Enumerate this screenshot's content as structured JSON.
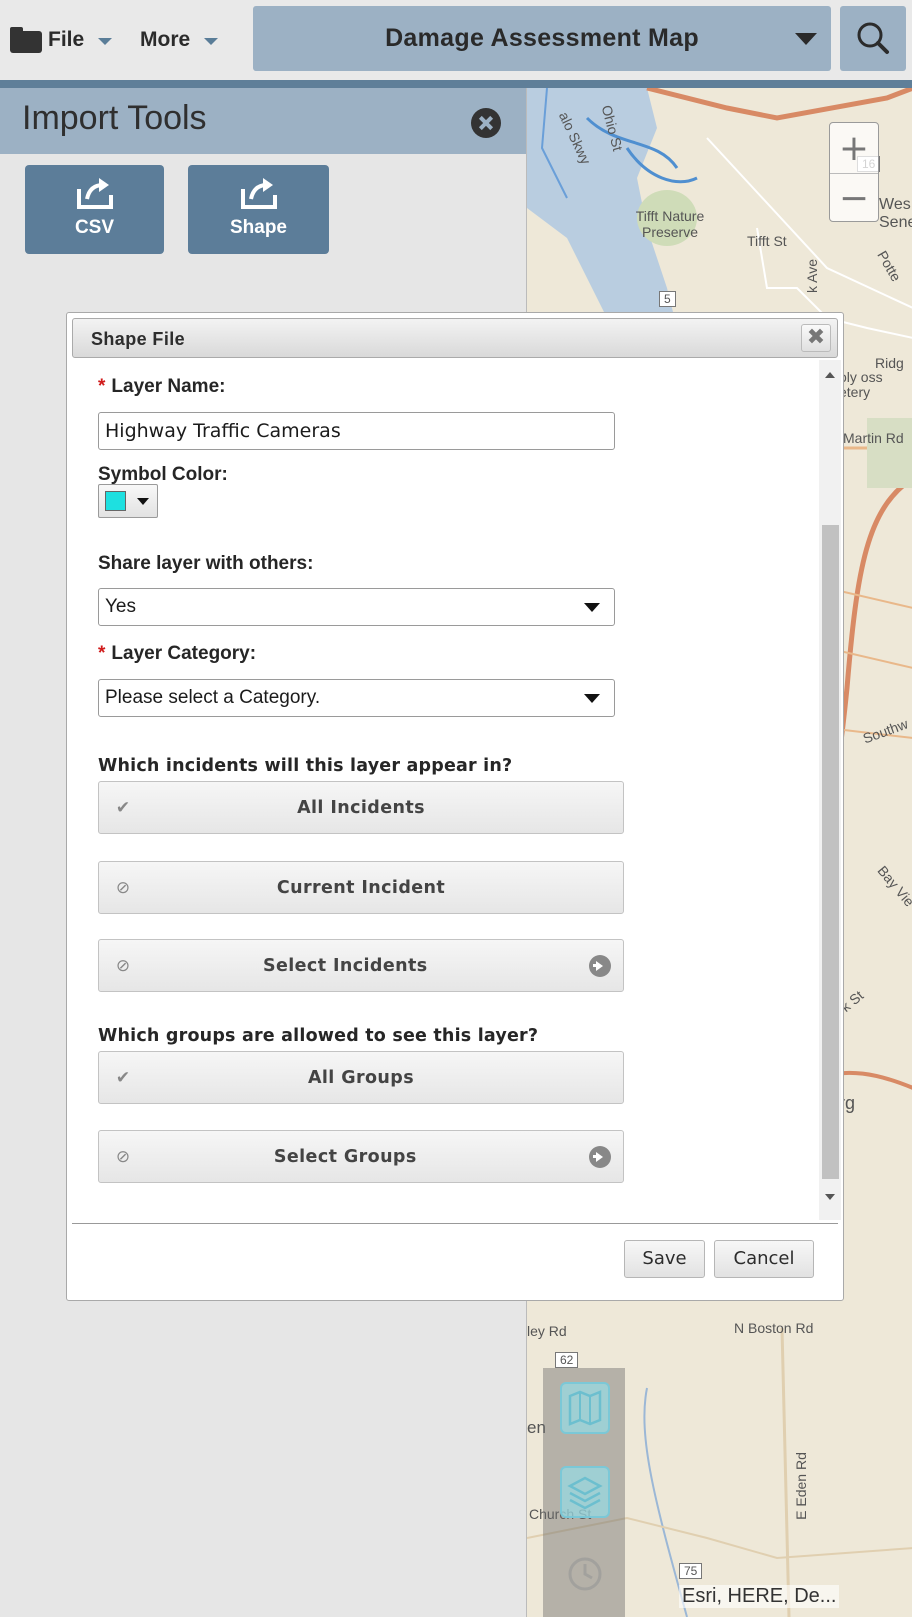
{
  "topbar": {
    "file_label": "File",
    "more_label": "More",
    "map_title": "Damage Assessment Map"
  },
  "import_panel": {
    "title": "Import Tools",
    "tools": [
      {
        "label": "CSV"
      },
      {
        "label": "Shape"
      }
    ]
  },
  "dialog": {
    "title": "Shape File",
    "close_glyph": "✖",
    "layer_name": {
      "label": "Layer Name:",
      "value": "Highway Traffic Cameras"
    },
    "symbol_color": {
      "label": "Symbol Color:",
      "value": "#1ee0e0"
    },
    "share_layer": {
      "label": "Share layer with others:",
      "value": "Yes"
    },
    "layer_category": {
      "label": "Layer Category:",
      "value": "Please select a Category."
    },
    "incidents": {
      "question": "Which incidents will this layer appear in?",
      "options": [
        {
          "label": "All Incidents",
          "state": "checked"
        },
        {
          "label": "Current Incident",
          "state": "unchecked"
        },
        {
          "label": "Select Incidents",
          "state": "unchecked",
          "has_nav": true
        }
      ]
    },
    "groups": {
      "question": "Which groups are allowed to see this layer?",
      "options": [
        {
          "label": "All Groups",
          "state": "checked"
        },
        {
          "label": "Select Groups",
          "state": "unchecked",
          "has_nav": true
        }
      ]
    },
    "save_label": "Save",
    "cancel_label": "Cancel"
  },
  "map": {
    "zoom_in": "+",
    "zoom_out": "−",
    "labels": [
      "Ohio St",
      "Tifft Nature Preserve",
      "Tifft St",
      "Wes Sene",
      "Ridg",
      "Martin Rd",
      "Southw",
      "Bay Vie",
      "k St",
      "rg",
      "N Boston Rd",
      "ley Rd",
      "en",
      "Church St",
      "E Eden Rd",
      "alo Skwy",
      "k Ave",
      "Potte",
      "oly oss etery"
    ],
    "route_shields": [
      "5",
      "62",
      "75",
      "16"
    ],
    "attribution": "Esri, HERE, De..."
  }
}
